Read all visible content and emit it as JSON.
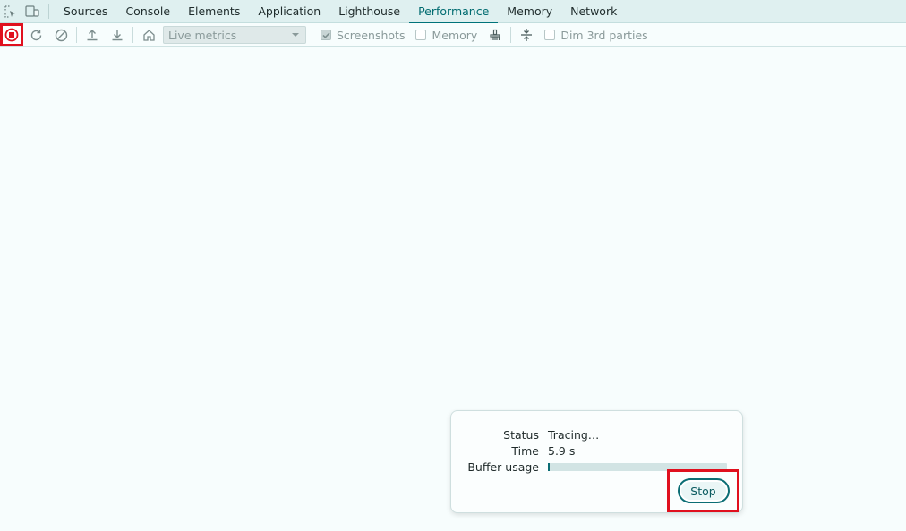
{
  "tabs": [
    "Sources",
    "Console",
    "Elements",
    "Application",
    "Lighthouse",
    "Performance",
    "Memory",
    "Network"
  ],
  "active_tab": "Performance",
  "toolbar": {
    "live_metrics_label": "Live metrics",
    "screenshots_label": "Screenshots",
    "memory_label": "Memory",
    "dim_third_parties_label": "Dim 3rd parties",
    "screenshots_checked": true,
    "memory_checked": false,
    "dim_checked": false
  },
  "recording_panel": {
    "status_label": "Status",
    "status_value": "Tracing…",
    "time_label": "Time",
    "time_value": "5.9 s",
    "buffer_label": "Buffer usage",
    "buffer_fraction": 0.01,
    "stop_label": "Stop"
  },
  "colors": {
    "accent": "#00737a",
    "highlight": "#e0101e",
    "background": "#f7fdfd"
  }
}
